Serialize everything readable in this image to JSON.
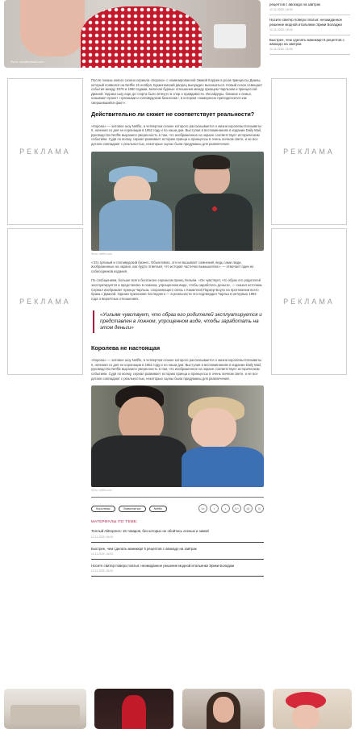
{
  "hero": {
    "credit": "Фото: shutterstock.com"
  },
  "news_top": [
    {
      "title": "рецептов с авокадо на завтрак",
      "date": "12.11.2020, 16:00"
    },
    {
      "title": "Носите свитер поверх платья: неожиданное решение модной итальянки Эрики Боладжи",
      "date": "12.11.2020, 16:00"
    },
    {
      "title": "Быстрее, чем сделать маникюр! 5 рецептов с авокадо на завтрак",
      "date": "12.11.2020, 16:00"
    }
  ],
  "ads": {
    "label": "РЕКЛАМА"
  },
  "article": {
    "intro": "После показа нового сезона сериала «Корона» с номинированной Эммой Коррин в роли принцессы Дианы, который появился на Netflix 15 ноября, Букингемский дворец вынужден высказаться. Новый сезон освещает события между 1979 и 1990 годами, включая бурные отношения между принцем Чарльзом и принцессой Дианой. Однако шоу еще до старта было втянуто в спор о правдивости. Инсайдеры, близкие к семье, называют проект «грязными и голливудским бизнесом», в котором «намеренно преподносится как свершившийся факт».",
    "h2_1": "Действительно ли сюжет не соответствует реальности?",
    "p1": "«Корона» — хитовое шоу Netflix, в четвертом сезоне которого рассказывается о жизни королевы Елизаветы II, начиная со дня ее коронации в 1952 году и по наши дни. Выступая в воспоминаниях в издании Daily Mail, руководство Netflix выразило уверенность в том, что изображенное на экране соответствует историческим событиям. Судя по всему, сериал развивает историю принца и принцессы в очень личном свете, и не все детали совпадают с реальностью, некоторые сцены были придуманы для развлечения.",
    "photo_credit_1": "Фото: netflix.com",
    "p2": "«Это грязный и голливудский бизнес. Объективно, это не вызывает сомнений, ведь сами люди, изображенные на экране, как будто отвечают, что история частично вымышлена», — отмечает один из собеседников издания.",
    "p3": "По сообщениям, больше всего беспокоен сериалом принц Уильям. «Он чувствует, что образ его родителей эксплуатируется и представлен в ложном, упрощенном виде, чтобы заработать деньги», — сказал источник. Сериал изображает принца Чарльза, сохраняющего связь с Камиллой Паркер-Боулз на протяжении всего брака с Дианой. Однако признание последнего — в реальности это подтвердил Чарльз в интервью 1994 года о вероятных отношениях.",
    "quote": "«Уильям чувствует, что образ его родителей эксплуатируется и представлен в ложном, упрощенном виде, чтобы заработать на этом деньги»",
    "h2_2": "Королева не настоящая",
    "p4": "«Корона» — хитовое шоу Netflix, в четвертом сезоне которого рассказывается о жизни королевы Елизаветы II, начиная со дня ее коронации в 1952 году и по наши дни. Выступая в воспоминаниях в издании Daily Mail, руководство Netflix выразило уверенность в том, что изображенное на экране соответствует историческим событиям. Судя по всему, сериал развивает историю принца и принцессы в очень личном свете, и не все детали совпадают с реальностью, некоторые сцены были придуманы для развлечения.",
    "photo_credit_2": "Фото: netflix.com"
  },
  "tags": [
    "Королевы",
    "Знаменитые",
    "Netflix"
  ],
  "socials": [
    "vk-icon",
    "facebook-icon",
    "twitter-icon",
    "google-icon",
    "mail-icon",
    "instagram-icon"
  ],
  "social_glyphs": [
    "vk",
    "f",
    "t",
    "G+",
    "@",
    "◎"
  ],
  "more": {
    "title": "МАТЕРИАЛЫ ПО ТЕМЕ:",
    "items": [
      {
        "title": "Теплый AliExpress: 15 товаров, без которых не обойтись осенью и зимой",
        "date": "12.11.2020, 16:00"
      },
      {
        "title": "Быстрее, чем сделать маникюр! 5 рецептов с авокадо на завтрак",
        "date": "12.11.2020, 16:00"
      },
      {
        "title": "Носите свитер поверх платья: неожиданное решение модной итальянки Эрики Боладжи",
        "date": "12.11.2020, 16:00"
      }
    ]
  },
  "colors": {
    "accent": "#b0163f",
    "text": "#222222",
    "muted": "#999999"
  }
}
